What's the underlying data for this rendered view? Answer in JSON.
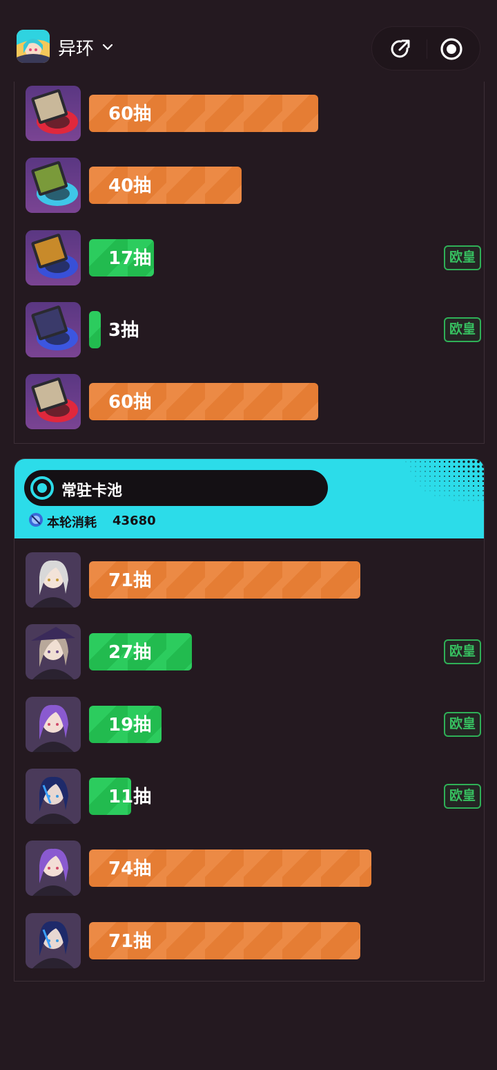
{
  "header": {
    "app_name": "异环",
    "chevron_icon": "chevron-down-icon",
    "share_icon": "share-icon",
    "target_icon": "target-icon"
  },
  "colors": {
    "background": "#241920",
    "orange_bar": "#e9833c",
    "green_bar": "#26c456",
    "pool_header": "#2cdce9",
    "badge": "#37c060"
  },
  "section1": {
    "rows": [
      {
        "thumb": "vinyl-red",
        "label": "60抽",
        "pulls": 60,
        "color": "orange",
        "badge": ""
      },
      {
        "thumb": "vinyl-cyan",
        "label": "40抽",
        "pulls": 40,
        "color": "orange",
        "badge": ""
      },
      {
        "thumb": "vinyl-blue-gold",
        "label": "17抽",
        "pulls": 17,
        "color": "green",
        "badge": "欧皇"
      },
      {
        "thumb": "vinyl-blue-dark",
        "label": "3抽",
        "pulls": 3,
        "color": "green",
        "badge": "欧皇"
      },
      {
        "thumb": "vinyl-red",
        "label": "60抽",
        "pulls": 60,
        "color": "orange",
        "badge": ""
      }
    ]
  },
  "section2": {
    "pool_title": "常驻卡池",
    "cost_label": "本轮消耗",
    "cost_value": "43680",
    "rows": [
      {
        "thumb": "char-white-hair",
        "label": "71抽",
        "pulls": 71,
        "color": "orange",
        "badge": ""
      },
      {
        "thumb": "char-witch-hat",
        "label": "27抽",
        "pulls": 27,
        "color": "green",
        "badge": "欧皇"
      },
      {
        "thumb": "char-purple-hair",
        "label": "19抽",
        "pulls": 19,
        "color": "green",
        "badge": "欧皇"
      },
      {
        "thumb": "char-blue-hair",
        "label": "11抽",
        "pulls": 11,
        "color": "green",
        "badge": "欧皇"
      },
      {
        "thumb": "char-purple-hair",
        "label": "74抽",
        "pulls": 74,
        "color": "orange",
        "badge": ""
      },
      {
        "thumb": "char-blue-hair",
        "label": "71抽",
        "pulls": 71,
        "color": "orange",
        "badge": ""
      }
    ]
  }
}
